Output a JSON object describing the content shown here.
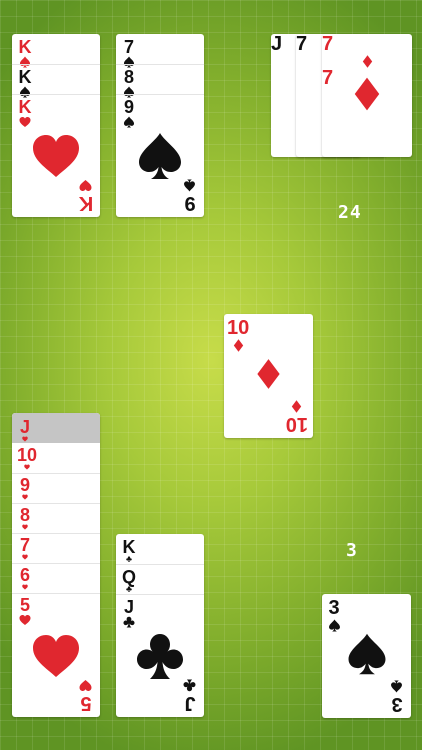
{
  "top_left_pile": {
    "cards": [
      {
        "rank": "K",
        "suit": "spade"
      },
      {
        "rank": "K",
        "suit": "spade"
      },
      {
        "rank": "K",
        "suit": "heart"
      }
    ]
  },
  "top_second_pile": {
    "cards": [
      {
        "rank": "7",
        "suit": "spade"
      },
      {
        "rank": "8",
        "suit": "spade"
      },
      {
        "rank": "9",
        "suit": "spade"
      }
    ]
  },
  "waste": {
    "cards": [
      {
        "rank": "J",
        "suit": "spade"
      },
      {
        "rank": "7",
        "suit": "club"
      },
      {
        "rank": "7",
        "suit": "diamond"
      }
    ]
  },
  "stock_count": "24",
  "center_card": {
    "rank": "10",
    "suit": "diamond"
  },
  "bottom_left_pile": {
    "cards": [
      {
        "rank": "J",
        "suit": "heart"
      },
      {
        "rank": "10",
        "suit": "heart"
      },
      {
        "rank": "9",
        "suit": "heart"
      },
      {
        "rank": "8",
        "suit": "heart"
      },
      {
        "rank": "7",
        "suit": "heart"
      },
      {
        "rank": "6",
        "suit": "heart"
      },
      {
        "rank": "5",
        "suit": "heart"
      }
    ]
  },
  "bottom_second_pile": {
    "cards": [
      {
        "rank": "K",
        "suit": "club"
      },
      {
        "rank": "Q",
        "suit": "club"
      },
      {
        "rank": "J",
        "suit": "club"
      }
    ]
  },
  "hand_count": "3",
  "hand_card": {
    "rank": "3",
    "suit": "spade"
  },
  "colors": {
    "red": "#e0272f",
    "black": "#111111",
    "felt": "#a6c93a"
  }
}
